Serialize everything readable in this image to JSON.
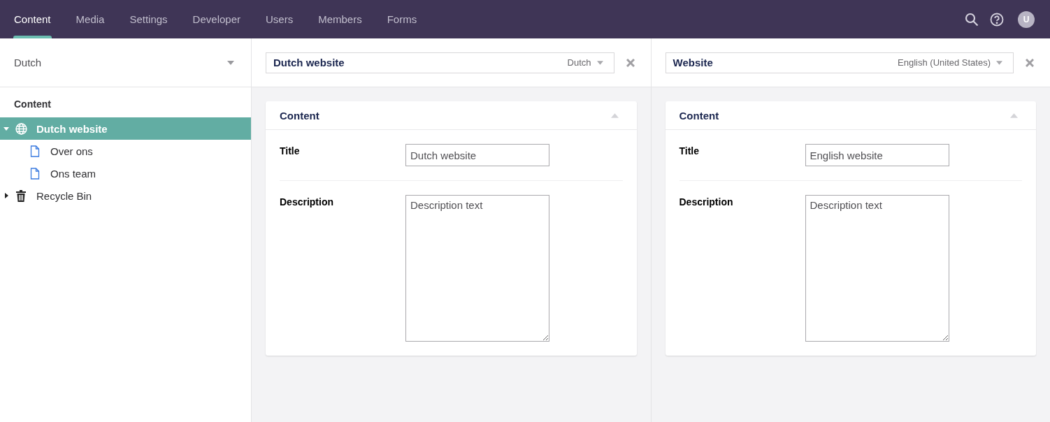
{
  "nav": {
    "tabs": [
      {
        "label": "Content",
        "selected": true
      },
      {
        "label": "Media",
        "selected": false
      },
      {
        "label": "Settings",
        "selected": false
      },
      {
        "label": "Developer",
        "selected": false
      },
      {
        "label": "Users",
        "selected": false
      },
      {
        "label": "Members",
        "selected": false
      },
      {
        "label": "Forms",
        "selected": false
      }
    ],
    "avatar": "U"
  },
  "sidebar": {
    "language": "Dutch",
    "section": "Content",
    "tree": [
      {
        "label": "Dutch website",
        "kind": "site",
        "selected": true,
        "expanded": true,
        "children": [
          {
            "label": "Over ons",
            "kind": "page",
            "selected": false
          },
          {
            "label": "Ons team",
            "kind": "page",
            "selected": false
          }
        ]
      },
      {
        "label": "Recycle Bin",
        "kind": "bin",
        "selected": false,
        "expanded": false
      }
    ]
  },
  "editors": [
    {
      "name": "Dutch website",
      "language": "Dutch",
      "group": "Content",
      "fields": [
        {
          "kind": "text",
          "label": "Title",
          "value": "Dutch website"
        },
        {
          "kind": "textarea",
          "label": "Description",
          "value": "Description text"
        }
      ]
    },
    {
      "name": "Website",
      "language": "English (United States)",
      "group": "Content",
      "fields": [
        {
          "kind": "text",
          "label": "Title",
          "value": "English website"
        },
        {
          "kind": "textarea",
          "label": "Description",
          "value": "Description text"
        }
      ]
    }
  ]
}
